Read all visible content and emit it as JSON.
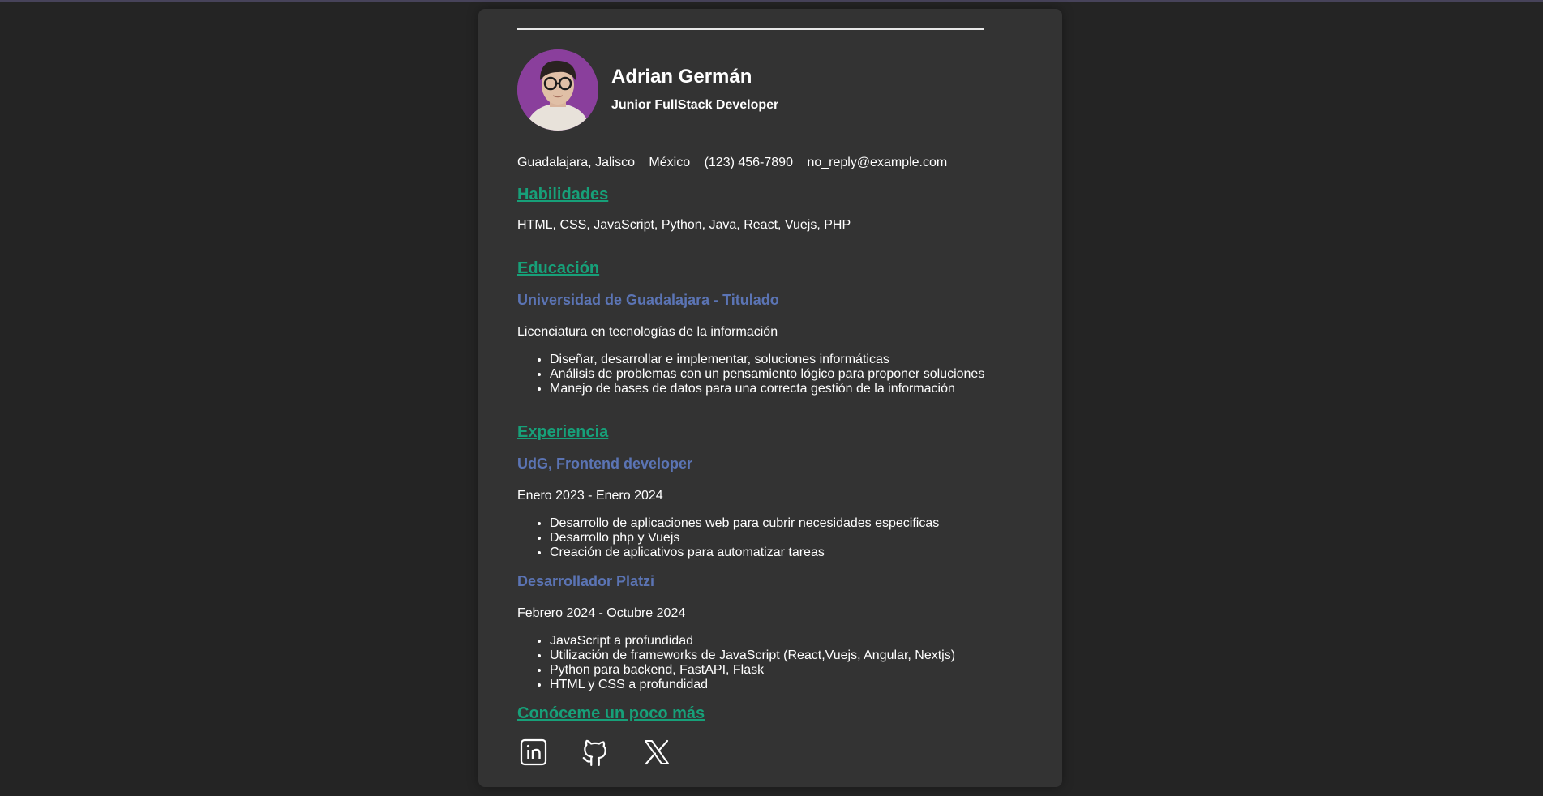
{
  "profile": {
    "name": "Adrian Germán",
    "role": "Junior FullStack Developer"
  },
  "contact": {
    "city": "Guadalajara, Jalisco",
    "country": "México",
    "phone": "(123) 456-7890",
    "email": "no_reply@example.com"
  },
  "skills": {
    "title": "Habilidades",
    "list": "HTML, CSS, JavaScript, Python, Java, React, Vuejs, PHP"
  },
  "education": {
    "title": "Educación",
    "school": "Universidad de Guadalajara - Titulado",
    "degree": "Licenciatura en tecnologías de la información",
    "points": [
      "Diseñar, desarrollar e implementar, soluciones informáticas",
      "Análisis de problemas con un pensamiento lógico para proponer soluciones",
      "Manejo de bases de datos para una correcta gestión de la información"
    ]
  },
  "experience": {
    "title": "Experiencia",
    "jobs": [
      {
        "position": "UdG, Frontend developer",
        "period": "Enero 2023 - Enero 2024",
        "points": [
          "Desarrollo de aplicaciones web para cubrir necesidades especificas",
          "Desarrollo php y Vuejs",
          "Creación de aplicativos para automatizar tareas"
        ]
      },
      {
        "position": "Desarrollador Platzi",
        "period": "Febrero 2024 - Octubre 2024",
        "points": [
          "JavaScript a profundidad",
          "Utilización de frameworks de JavaScript (React,Vuejs, Angular, Nextjs)",
          "Python para backend, FastAPI, Flask",
          "HTML y CSS a profundidad"
        ]
      }
    ]
  },
  "more": {
    "title": "Conóceme un poco más",
    "links": [
      "linkedin-icon",
      "github-icon",
      "x-twitter-icon"
    ]
  },
  "colors": {
    "background": "#242424",
    "card": "#333333",
    "section_title": "#17a079",
    "subheading": "#5b74b4",
    "text": "#ffffff"
  }
}
